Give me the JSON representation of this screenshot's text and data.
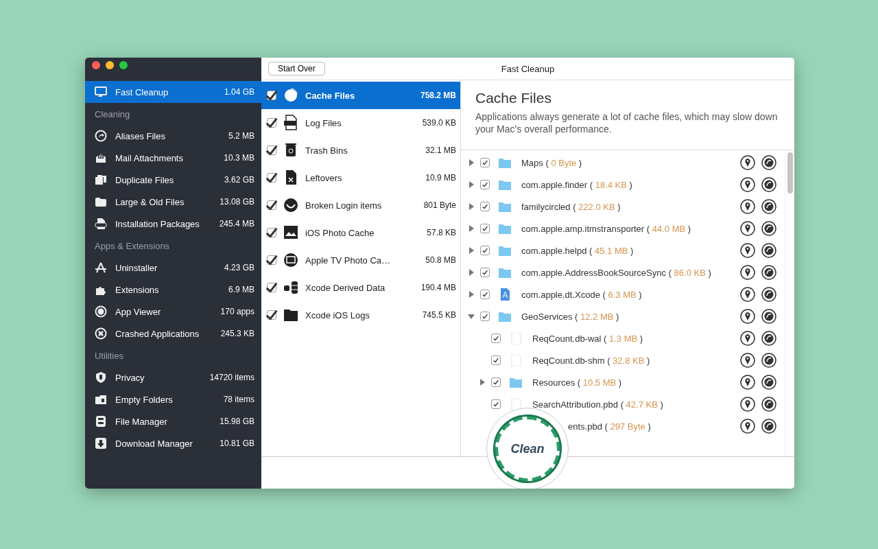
{
  "window": {
    "title": "Fast Cleanup",
    "start_over": "Start Over"
  },
  "sidebar": {
    "items": [
      {
        "kind": "item",
        "label": "Fast Cleanup",
        "value": "1.04 GB",
        "selected": true
      },
      {
        "kind": "section",
        "label": "Cleaning"
      },
      {
        "kind": "item",
        "label": "Aliases Files",
        "value": "5.2 MB",
        "selected": false
      },
      {
        "kind": "item",
        "label": "Mail Attachments",
        "value": "10.3 MB",
        "selected": false
      },
      {
        "kind": "item",
        "label": "Duplicate Files",
        "value": "3.62 GB",
        "selected": false
      },
      {
        "kind": "item",
        "label": "Large & Old Files",
        "value": "13.08 GB",
        "selected": false
      },
      {
        "kind": "item",
        "label": "Installation Packages",
        "value": "245.4 MB",
        "selected": false
      },
      {
        "kind": "section",
        "label": "Apps & Extensions"
      },
      {
        "kind": "item",
        "label": "Uninstaller",
        "value": "4.23 GB",
        "selected": false
      },
      {
        "kind": "item",
        "label": "Extensions",
        "value": "6.9 MB",
        "selected": false
      },
      {
        "kind": "item",
        "label": "App Viewer",
        "value": "170 apps",
        "selected": false
      },
      {
        "kind": "item",
        "label": "Crashed Applications",
        "value": "245.3 KB",
        "selected": false
      },
      {
        "kind": "section",
        "label": "Utilities"
      },
      {
        "kind": "item",
        "label": "Privacy",
        "value": "14720 items",
        "selected": false
      },
      {
        "kind": "item",
        "label": "Empty Folders",
        "value": "78 items",
        "selected": false
      },
      {
        "kind": "item",
        "label": "File Manager",
        "value": "15.98 GB",
        "selected": false
      },
      {
        "kind": "item",
        "label": "Download Manager",
        "value": "10.81 GB",
        "selected": false
      }
    ]
  },
  "categories": [
    {
      "label": "Cache Files",
      "size": "758.2 MB",
      "checked": true,
      "selected": true
    },
    {
      "label": "Log Files",
      "size": "539.0 KB",
      "checked": true,
      "selected": false
    },
    {
      "label": "Trash Bins",
      "size": "32.1 MB",
      "checked": true,
      "selected": false
    },
    {
      "label": "Leftovers",
      "size": "10.9 MB",
      "checked": true,
      "selected": false
    },
    {
      "label": "Broken Login items",
      "size": "801 Byte",
      "checked": true,
      "selected": false
    },
    {
      "label": "iOS Photo Cache",
      "size": "57.8 KB",
      "checked": true,
      "selected": false
    },
    {
      "label": "Apple TV Photo Ca…",
      "size": "50.8 MB",
      "checked": true,
      "selected": false
    },
    {
      "label": "Xcode Derived Data",
      "size": "190.4 MB",
      "checked": true,
      "selected": false
    },
    {
      "label": "Xcode iOS Logs",
      "size": "745.5 KB",
      "checked": true,
      "selected": false
    }
  ],
  "detail": {
    "title": "Cache Files",
    "description": "Applications always generate a lot of cache files, which may slow down your Mac's overall performance.",
    "tree": [
      {
        "kind": "folder",
        "name": "Maps",
        "size": "( 0 Byte )",
        "checked": true,
        "expanded": false
      },
      {
        "kind": "folder",
        "name": "com.apple.finder",
        "size": "( 18.4 KB )",
        "checked": true,
        "expanded": false
      },
      {
        "kind": "folder",
        "name": "familycircled",
        "size": "( 222.0 KB )",
        "checked": true,
        "expanded": false
      },
      {
        "kind": "folder",
        "name": "com.apple.amp.itmstransporter",
        "size": "( 44.0 MB )",
        "checked": true,
        "expanded": false
      },
      {
        "kind": "folder",
        "name": "com.apple.helpd",
        "size": "( 45.1 MB )",
        "checked": true,
        "expanded": false
      },
      {
        "kind": "folder",
        "name": "com.apple.AddressBookSourceSync",
        "size": "( 86.0 KB )",
        "checked": true,
        "expanded": false
      },
      {
        "kind": "app",
        "name": "com.apple.dt.Xcode",
        "size": "( 6.3 MB )",
        "checked": true,
        "expanded": false
      },
      {
        "kind": "folder",
        "name": "GeoServices",
        "size": "( 12.2 MB )",
        "checked": true,
        "expanded": true,
        "children": [
          {
            "kind": "file",
            "name": "ReqCount.db-wal",
            "size": "( 1.3 MB )",
            "checked": true
          },
          {
            "kind": "file",
            "name": "ReqCount.db-shm",
            "size": "( 32.8 KB )",
            "checked": true
          },
          {
            "kind": "folder",
            "name": "Resources",
            "size": "( 10.5 MB )",
            "checked": true,
            "expanded": false
          },
          {
            "kind": "file",
            "name": "SearchAttribution.pbd",
            "size": "( 42.7 KB )",
            "checked": true
          },
          {
            "kind": "covered",
            "name": "ents.pbd",
            "size": "( 297 Byte )"
          }
        ]
      }
    ]
  },
  "clean_button": {
    "label": "Clean"
  }
}
